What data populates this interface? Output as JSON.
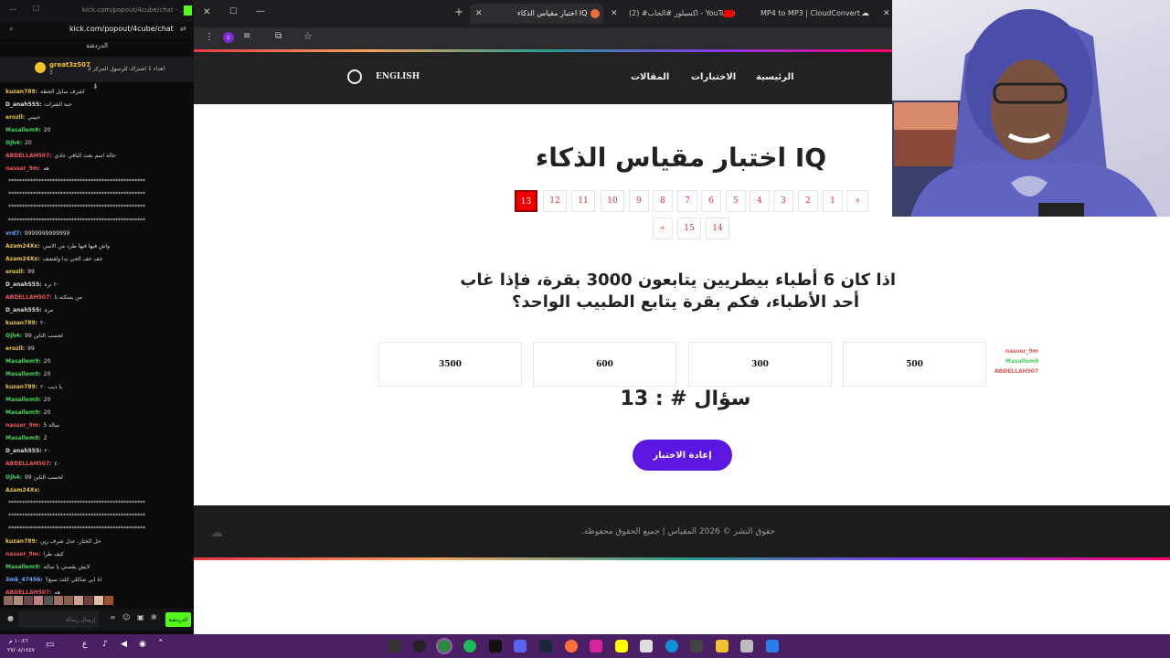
{
  "chat": {
    "url": "kick.com/popout/4cube/chat",
    "titlebar_url": "kick.com/popout/4cube/chat - ...",
    "header": "الدردشة",
    "pinned_user": "great3z507",
    "pinned_text": "أهداء 1 اشتراك للرسول المركز 2",
    "pinned_sub": "3",
    "messages": [
      {
        "user": "kuzan789:",
        "text": "اشرف سايل الحظة",
        "color": "#e6c44a"
      },
      {
        "user": "D_anah555:",
        "text": "حبة الشرات",
        "color": "#ddd"
      },
      {
        "user": "erozll:",
        "text": "حبيني",
        "color": "#e6c44a"
      },
      {
        "user": "Masallem9:",
        "text": "20",
        "color": "#4ccf5c"
      },
      {
        "user": "Ojh4:",
        "text": "20",
        "color": "#4ccf5c"
      },
      {
        "user": "ABDELLAH507:",
        "text": "حالة اسم بعث الباقي عادي",
        "color": "#e65858"
      },
      {
        "user": "nasser_9m:",
        "text": "هه",
        "color": "#e65858"
      },
      {
        "user": "",
        "text": "**************************************************",
        "color": "#ddd"
      },
      {
        "user": "",
        "text": "**************************************************",
        "color": "#ddd"
      },
      {
        "user": "",
        "text": "**************************************************",
        "color": "#ddd"
      },
      {
        "user": "",
        "text": "**************************************************",
        "color": "#ddd"
      },
      {
        "user": "vrd7:",
        "text": "9999999999999",
        "color": "#6aa8ff"
      },
      {
        "user": "Azam24Xx:",
        "text": "واش فيها فيها طرد من الاسن",
        "color": "#e6c44a"
      },
      {
        "user": "Azam24Xx:",
        "text": "خف خف الحي بدا ولقشف",
        "color": "#e6c44a"
      },
      {
        "user": "erozll:",
        "text": "99",
        "color": "#e6c44a"
      },
      {
        "user": "D_anah555:",
        "text": "٢٠ نره",
        "color": "#ddd"
      },
      {
        "user": "ABDELLAH507:",
        "text": "من يسكنه تا",
        "color": "#e65858"
      },
      {
        "user": "D_anah555:",
        "text": "مره",
        "color": "#ddd"
      },
      {
        "user": "kuzan789:",
        "text": "٢٠",
        "color": "#e6c44a"
      },
      {
        "user": "Ojh4:",
        "text": "99 لحسب الثاين",
        "color": "#4ccf5c"
      },
      {
        "user": "erozll:",
        "text": "99",
        "color": "#e6c44a"
      },
      {
        "user": "Masallem9:",
        "text": "20",
        "color": "#4ccf5c"
      },
      {
        "user": "Masallem9:",
        "text": "20",
        "color": "#4ccf5c"
      },
      {
        "user": "kuzan789:",
        "text": "يا ذيب ٢٠",
        "color": "#e6c44a"
      },
      {
        "user": "Masallem9:",
        "text": "20",
        "color": "#4ccf5c"
      },
      {
        "user": "Masallem9:",
        "text": "20",
        "color": "#4ccf5c"
      },
      {
        "user": "nasser_9m:",
        "text": "سالة 5",
        "color": "#e65858"
      },
      {
        "user": "Masallem9:",
        "text": "2",
        "color": "#4ccf5c"
      },
      {
        "user": "D_anah555:",
        "text": "٢٠",
        "color": "#ddd"
      },
      {
        "user": "ABDELLAH507:",
        "text": "٤٠",
        "color": "#e65858"
      },
      {
        "user": "Ojh4:",
        "text": "99 لحسب الثاين",
        "color": "#4ccf5c"
      },
      {
        "user": "Azam24Xx:",
        "text": "",
        "color": "#e6c44a"
      },
      {
        "user": "",
        "text": "**************************************************",
        "color": "#ddd"
      },
      {
        "user": "",
        "text": "**************************************************",
        "color": "#ddd"
      },
      {
        "user": "",
        "text": "**************************************************",
        "color": "#ddd"
      },
      {
        "user": "kuzan789:",
        "text": "حل الختار، عدل شرف زين",
        "color": "#e6c44a"
      },
      {
        "user": "nasser_9m:",
        "text": "كيف طرا",
        "color": "#e65858"
      },
      {
        "user": "Masallem9:",
        "text": "لايش يقصني يا سالة",
        "color": "#4ccf5c"
      },
      {
        "user": "3mk_47456:",
        "text": "انا ابي شاكلي كلت سبع؟",
        "color": "#6aa8ff"
      },
      {
        "user": "ABDELLAH507:",
        "text": "هه",
        "color": "#e65858"
      }
    ],
    "input_placeholder": "إرسال رسالة",
    "send_label": "الدردشة"
  },
  "browser": {
    "tabs": [
      "اختبار مقياس الذكاء IQ",
      "(2) #اكسبلور #الحاب - YouTube",
      "MP4 to MP3 | CloudConvert"
    ]
  },
  "site": {
    "nav": {
      "home": "الرئيسية",
      "tests": "الاختبارات",
      "articles": "المقالات",
      "lang": "ENGLISH"
    },
    "title": "اختبار مقياس الذكاء IQ",
    "pagination_row1": [
      "13",
      "12",
      "11",
      "10",
      "9",
      "8",
      "7",
      "6",
      "5",
      "4",
      "3",
      "2",
      "1",
      "»"
    ],
    "pagination_row2": [
      "«",
      "15",
      "14"
    ],
    "question_line1": "اذا كان 6 أطباء بيطريين يتابعون 3000 بقرة، فإذا غاب",
    "question_line2": "أحد الأطباء، فكم بقرة يتابع الطبيب الواحد؟",
    "answers": [
      "3500",
      "600",
      "300",
      "500"
    ],
    "question_number": "سؤال # : 13",
    "retry": "إعادة الاختبار",
    "footer": "حقوق النشر © 2026 المقياس | جميع الحقوق محفوظة."
  },
  "overlay": {
    "u1": "nasser_9m",
    "u2": "Masallem9",
    "u3": "ABDELLAH507"
  },
  "taskbar": {
    "time": "١٠:٤٦ م",
    "date": "٢٧/٠٨/١٤٤٧"
  },
  "colors": {
    "accent": "#5b16e0",
    "active_page": "#e00000",
    "kick_green": "#53fc18"
  }
}
